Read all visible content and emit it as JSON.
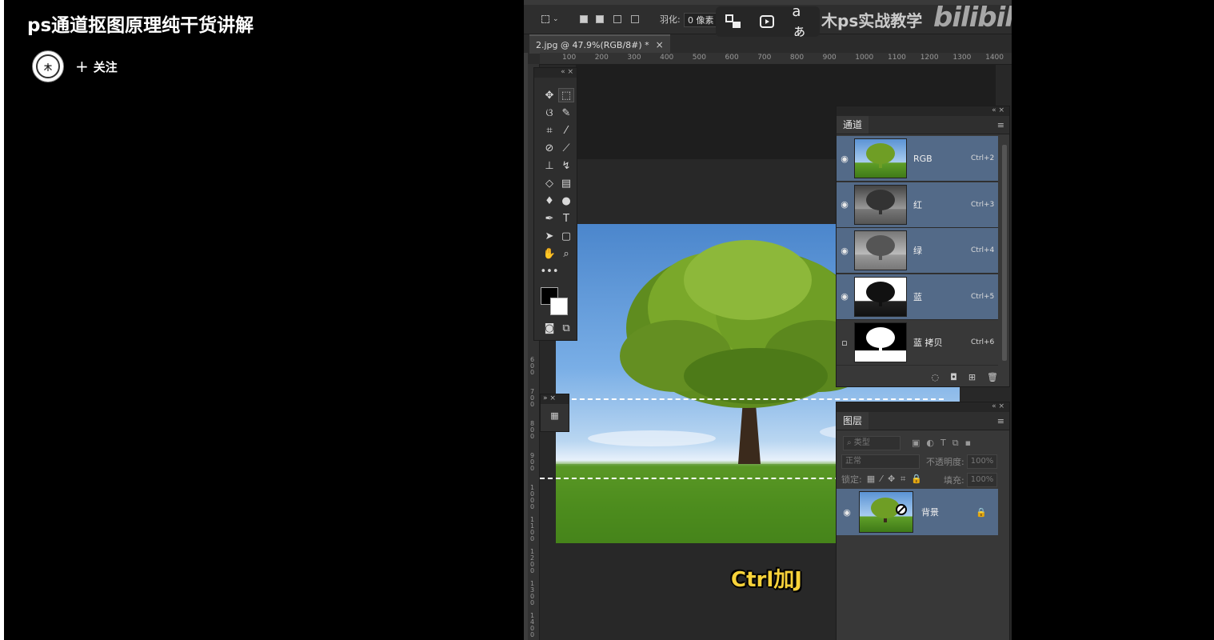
{
  "video": {
    "title": "ps通道抠图原理纯干货讲解",
    "follow_label": "关注",
    "avatar_text": "木"
  },
  "photoshop": {
    "options_bar": {
      "feather_label": "羽化:",
      "feather_value": "0 像素"
    },
    "watermark_text": "木ps实战教学",
    "watermark_logo": "bilibili",
    "document_tab": {
      "name": "2.jpg @ 47.9%(RGB/8#) *",
      "close": "×"
    },
    "ruler_top_ticks": [
      "100",
      "200",
      "300",
      "400",
      "500",
      "600",
      "700",
      "800",
      "900",
      "1000",
      "1100",
      "1200",
      "1300",
      "1400"
    ],
    "ruler_left_ticks": [
      "6\n0\n0",
      "7\n0\n0",
      "8\n0\n0",
      "9\n0\n0",
      "1\n0\n0\n0",
      "1\n1\n0\n0",
      "1\n2\n0\n0",
      "1\n3\n0\n0",
      "1\n4\n0\n0"
    ],
    "channels_panel": {
      "tab": "通道",
      "channels": [
        {
          "name": "RGB",
          "shortcut": "Ctrl+2",
          "visible": true,
          "selected": true
        },
        {
          "name": "红",
          "shortcut": "Ctrl+3",
          "visible": true,
          "selected": true
        },
        {
          "name": "绿",
          "shortcut": "Ctrl+4",
          "visible": true,
          "selected": true
        },
        {
          "name": "蓝",
          "shortcut": "Ctrl+5",
          "visible": true,
          "selected": true
        },
        {
          "name": "蓝 拷贝",
          "shortcut": "Ctrl+6",
          "visible": false,
          "selected": false
        }
      ]
    },
    "layers_panel": {
      "tab": "图层",
      "filter_label": "类型",
      "blend_mode": "正常",
      "opacity_label": "不透明度:",
      "opacity_value": "100%",
      "lock_label": "锁定:",
      "fill_label": "填充:",
      "fill_value": "100%",
      "layers": [
        {
          "name": "背景",
          "locked": true
        }
      ]
    },
    "subtitle": "Ctrl加J"
  },
  "colors": {
    "selected_row": "#536a88",
    "subtitle": "#f7d23a",
    "panel_bg": "#383838"
  }
}
